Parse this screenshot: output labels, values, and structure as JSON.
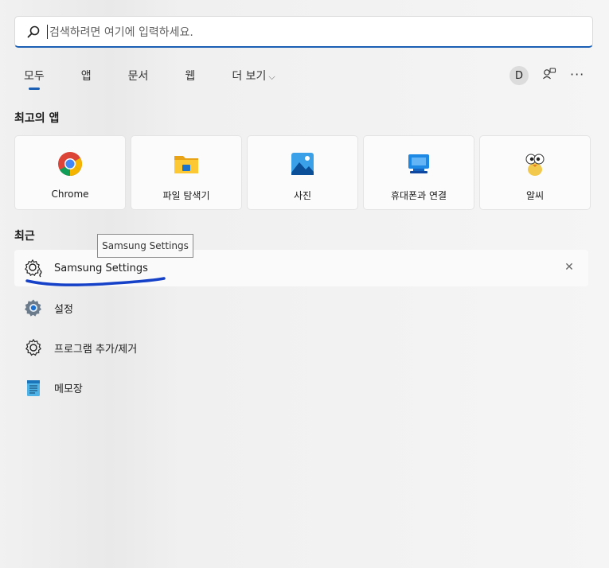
{
  "search": {
    "placeholder": "검색하려면 여기에 입력하세요."
  },
  "tabs": [
    {
      "label": "모두"
    },
    {
      "label": "앱"
    },
    {
      "label": "문서"
    },
    {
      "label": "웹"
    },
    {
      "label": "더 보기"
    }
  ],
  "header_right": {
    "avatar_letter": "D"
  },
  "top_apps": {
    "title": "최고의 앱",
    "items": [
      {
        "label": "Chrome",
        "icon": "chrome-icon"
      },
      {
        "label": "파일 탐색기",
        "icon": "folder-icon"
      },
      {
        "label": "사진",
        "icon": "photos-icon"
      },
      {
        "label": "휴대폰과 연결",
        "icon": "phone-link-icon"
      },
      {
        "label": "알씨",
        "icon": "alsee-icon"
      }
    ]
  },
  "recent": {
    "title": "최근",
    "tooltip": "Samsung Settings",
    "items": [
      {
        "label": "Samsung Settings",
        "icon": "samsung-settings-icon"
      },
      {
        "label": "설정",
        "icon": "settings-gear-icon"
      },
      {
        "label": "프로그램 추가/제거",
        "icon": "gear-icon"
      },
      {
        "label": "메모장",
        "icon": "notepad-icon"
      }
    ]
  },
  "colors": {
    "accent": "#1a5fb4",
    "annotation_stroke": "#1540c8"
  }
}
